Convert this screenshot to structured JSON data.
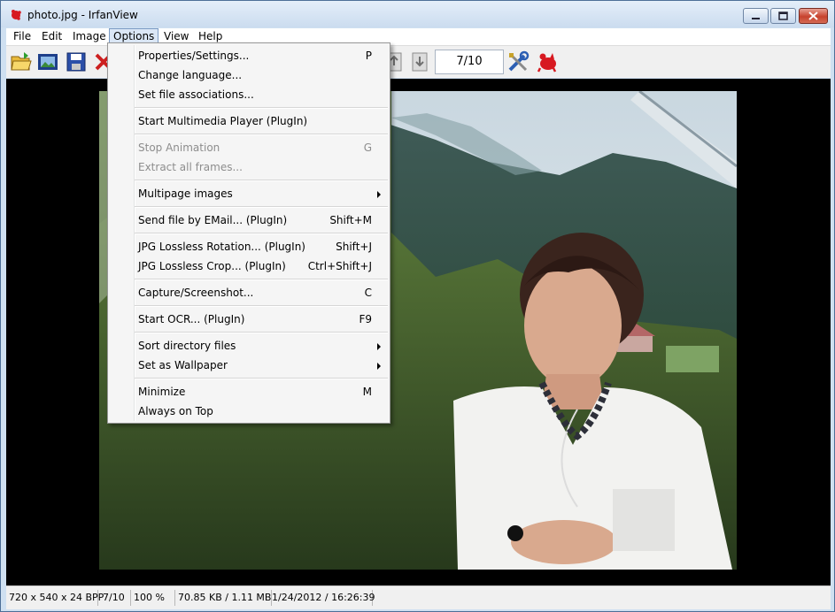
{
  "window": {
    "title": "photo.jpg - IrfanView"
  },
  "menubar": {
    "items": [
      "File",
      "Edit",
      "Image",
      "Options",
      "View",
      "Help"
    ]
  },
  "toolbar": {
    "counter": "7/10"
  },
  "options_menu": {
    "items": [
      {
        "label": "Properties/Settings...",
        "shortcut": "P"
      },
      {
        "label": "Change language...",
        "shortcut": ""
      },
      {
        "label": "Set file associations...",
        "shortcut": ""
      },
      {
        "label": "Start Multimedia Player (PlugIn)",
        "shortcut": ""
      },
      {
        "label": "Stop Animation",
        "shortcut": "G"
      },
      {
        "label": "Extract all frames...",
        "shortcut": ""
      },
      {
        "label": "Multipage images",
        "shortcut": ""
      },
      {
        "label": "Send file by EMail... (PlugIn)",
        "shortcut": "Shift+M"
      },
      {
        "label": "JPG Lossless Rotation... (PlugIn)",
        "shortcut": "Shift+J"
      },
      {
        "label": "JPG Lossless Crop... (PlugIn)",
        "shortcut": "Ctrl+Shift+J"
      },
      {
        "label": "Capture/Screenshot...",
        "shortcut": "C"
      },
      {
        "label": "Start OCR... (PlugIn)",
        "shortcut": "F9"
      },
      {
        "label": "Sort directory files",
        "shortcut": ""
      },
      {
        "label": "Set as Wallpaper",
        "shortcut": ""
      },
      {
        "label": "Minimize",
        "shortcut": "M"
      },
      {
        "label": "Always on Top",
        "shortcut": ""
      }
    ]
  },
  "statusbar": {
    "dimensions": "720 x 540 x 24 BPP",
    "index": "7/10",
    "zoom": "100 %",
    "filesize": "70.85 KB / 1.11 MB",
    "datetime": "1/24/2012 / 16:26:39"
  },
  "colors": {
    "menu_highlight": "#dbe7f6",
    "disabled_text": "#8d8d8d"
  }
}
